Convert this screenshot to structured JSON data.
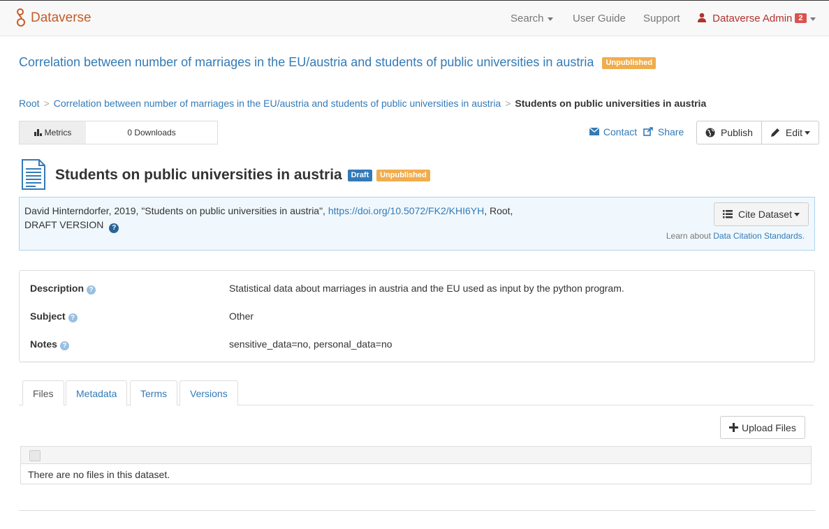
{
  "navbar": {
    "brand": "Dataverse",
    "search": "Search",
    "user_guide": "User Guide",
    "support": "Support",
    "user": "Dataverse Admin",
    "notification_count": "2"
  },
  "dataverse": {
    "title": "Correlation between number of marriages in the EU/austria and students of public universities in austria",
    "status": "Unpublished"
  },
  "breadcrumb": {
    "root": "Root",
    "parent": "Correlation between number of marriages in the EU/austria and students of public universities in austria",
    "current": "Students on public universities in austria"
  },
  "metrics": {
    "label": "Metrics",
    "downloads": "0 Downloads"
  },
  "actions": {
    "contact": "Contact",
    "share": "Share",
    "publish": "Publish",
    "edit": "Edit"
  },
  "dataset": {
    "title": "Students on public universities in austria",
    "badge_draft": "Draft",
    "badge_unpublished": "Unpublished"
  },
  "citation": {
    "text_prefix": "David Hinterndorfer, 2019, \"Students on public universities in austria\",",
    "doi": "https://doi.org/10.5072/FK2/KHI6YH",
    "text_suffix": ", Root,",
    "version": "DRAFT VERSION",
    "cite_button": "Cite Dataset",
    "learn_prefix": "Learn about",
    "learn_link": "Data Citation Standards."
  },
  "metadata": {
    "rows": [
      {
        "key": "Description",
        "value": "Statistical data about marriages in austria and the EU used as input by the python program."
      },
      {
        "key": "Subject",
        "value": "Other"
      },
      {
        "key": "Notes",
        "value": "sensitive_data=no, personal_data=no"
      }
    ]
  },
  "tabs": [
    "Files",
    "Metadata",
    "Terms",
    "Versions"
  ],
  "files": {
    "upload_button": "Upload Files",
    "empty_message": "There are no files in this dataset."
  }
}
